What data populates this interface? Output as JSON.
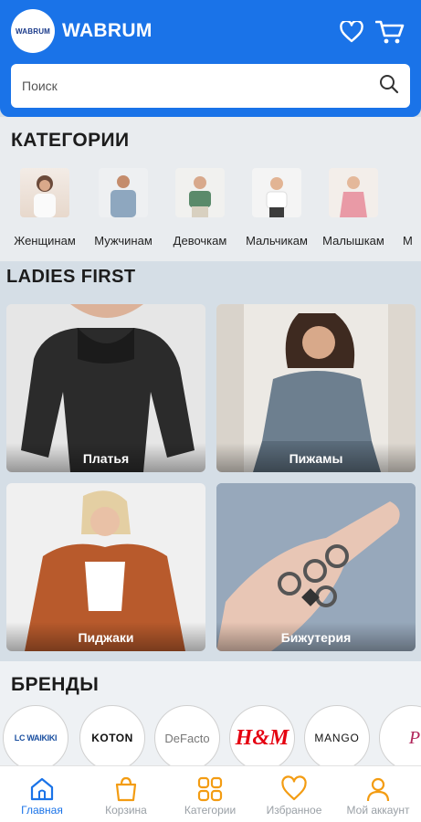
{
  "header": {
    "logo_text": "WABRUM",
    "app_title": "WABRUM",
    "favorites_icon": "heart-icon",
    "cart_icon": "cart-icon"
  },
  "search": {
    "placeholder": "Поиск",
    "icon": "search-icon"
  },
  "categories": {
    "title": "КАТЕГОРИИ",
    "items": [
      {
        "label": "Женщинам"
      },
      {
        "label": "Мужчинам"
      },
      {
        "label": "Девочкам"
      },
      {
        "label": "Мальчикам"
      },
      {
        "label": "Малышкам"
      },
      {
        "label": "М"
      }
    ]
  },
  "ladies_first": {
    "title": "LADIES FIRST",
    "tiles": [
      {
        "label": "Платья"
      },
      {
        "label": "Пижамы"
      },
      {
        "label": "Пиджаки"
      },
      {
        "label": "Бижутерия"
      }
    ]
  },
  "brands": {
    "title": "БРЕНДЫ",
    "items": [
      {
        "name": "LC WAIKIKI"
      },
      {
        "name": "KOTON"
      },
      {
        "name": "DeFacto"
      },
      {
        "name": "H&M"
      },
      {
        "name": "MANGO"
      },
      {
        "name": "Pu"
      }
    ]
  },
  "bottom_nav": {
    "items": [
      {
        "label": "Главная",
        "icon": "home-icon",
        "active": true
      },
      {
        "label": "Корзина",
        "icon": "bag-icon",
        "active": false
      },
      {
        "label": "Категории",
        "icon": "grid-icon",
        "active": false
      },
      {
        "label": "Избранное",
        "icon": "heart-icon",
        "active": false
      },
      {
        "label": "Мой аккаунт",
        "icon": "user-icon",
        "active": false
      }
    ]
  },
  "colors": {
    "primary": "#1a73e8",
    "accent_orange": "#f39c12",
    "inactive": "#9aa0a6"
  }
}
